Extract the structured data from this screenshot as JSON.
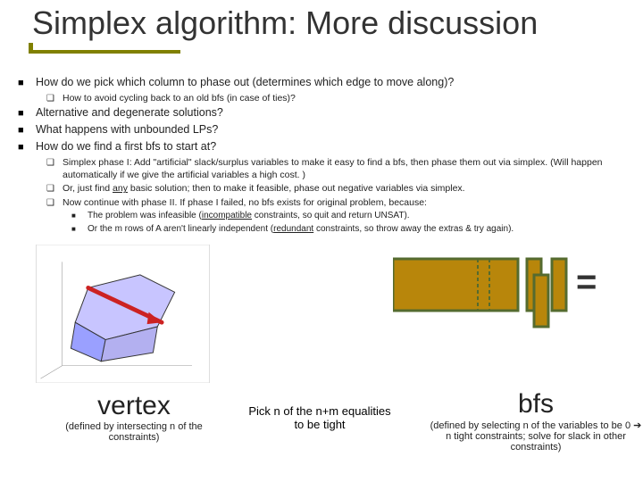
{
  "title": "Simplex algorithm: More discussion",
  "bullets": {
    "b1": "How do we pick which column to phase out (determines which edge to move along)?",
    "b1a": "How to avoid cycling back to an old bfs (in case of ties)?",
    "b2": "Alternative and degenerate solutions?",
    "b3": "What happens with unbounded LPs?",
    "b4": "How do we find a first bfs to start at?",
    "b4a": "Simplex phase I: Add \"artificial\" slack/surplus variables to make it easy to find a bfs, then phase them out via simplex. (Will happen automatically if we give the artificial variables a high cost. )",
    "b4b_pre": "Or, just find ",
    "b4b_u": "any",
    "b4b_post": " basic solution; then to make it feasible, phase out negative variables via simplex.",
    "b4c": "Now continue with phase II.   If phase I failed, no bfs exists for original problem, because:",
    "b4c1_pre": "The problem was infeasible (",
    "b4c1_u": "incompatible",
    "b4c1_post": " constraints, so quit and return UNSAT).",
    "b4c2_pre": "Or the m rows of A aren't linearly independent (",
    "b4c2_u": "redundant",
    "b4c2_post": " constraints, so throw away the extras & try again)."
  },
  "eq": "=",
  "captions": {
    "vertex_word": "vertex",
    "vertex_sub": "(defined by intersecting n of the constraints)",
    "middle": "Pick n of the n+m equalities to be tight",
    "bfs_word": "bfs",
    "bfs_sub": "(defined by selecting n of the variables to be 0 ➔ n tight constraints; solve for slack in other constraints)"
  },
  "colors": {
    "accent": "#808000",
    "bar_fill": "#b8860b",
    "bar_stroke": "#556b2f",
    "arrow": "#cc2222",
    "poly_edge": "#333333",
    "poly_face1": "#9aa0ff",
    "poly_face2": "#c8c5ff"
  }
}
